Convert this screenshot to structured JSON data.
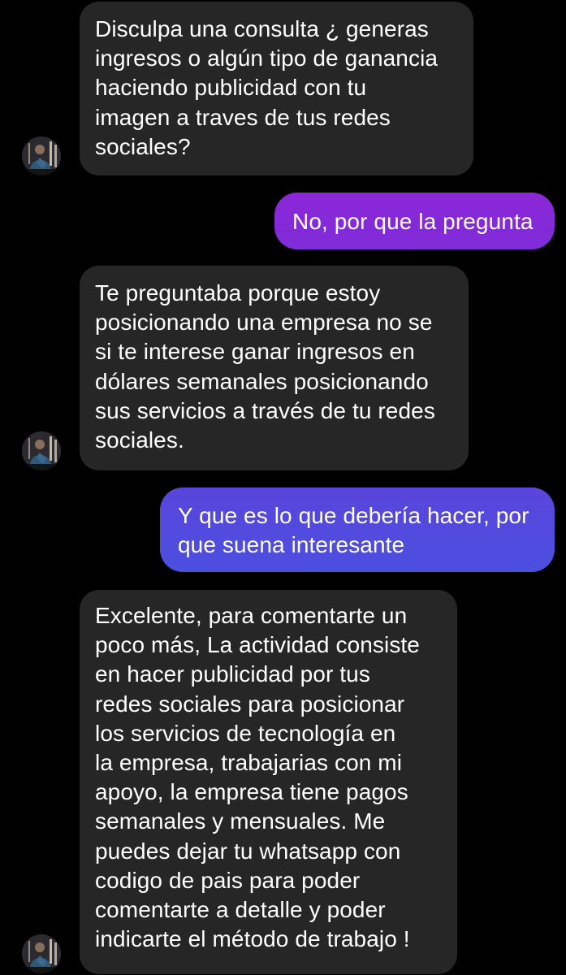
{
  "colors": {
    "background": "#000000",
    "incoming_bubble": "#262626",
    "outgoing_gradient_top": "#8a28d6",
    "outgoing_gradient_bottom": "#4c4fe0",
    "text": "#ffffff"
  },
  "messages": [
    {
      "direction": "incoming",
      "text": "Disculpa una consulta ¿ generas\ningresos o algún tipo de ganancia\nhaciendo publicidad con tu\nimagen a traves  de tus redes\nsociales?"
    },
    {
      "direction": "outgoing",
      "text": "No, por que la pregunta"
    },
    {
      "direction": "incoming",
      "text": "Te preguntaba porque estoy\nposicionando una empresa no se\nsi te interese ganar ingresos en\ndólares semanales posicionando\nsus servicios a través de tu redes\nsociales."
    },
    {
      "direction": "outgoing",
      "text": "Y que es lo que debería hacer, por\nque suena interesante"
    },
    {
      "direction": "incoming",
      "text": "Excelente, para comentarte un\npoco más, La actividad consiste\nen hacer publicidad por tus\nredes sociales para posicionar\nlos servicios de tecnología en\nla empresa, trabajarias con mi\napoyo, la empresa tiene pagos\nsemanales y mensuales. Me\npuedes dejar tu whatsapp con\ncodigo de pais para poder\ncomentarte a detalle y poder\nindicarte el método de trabajo !"
    }
  ],
  "avatar_icon": "profile-avatar-icon"
}
